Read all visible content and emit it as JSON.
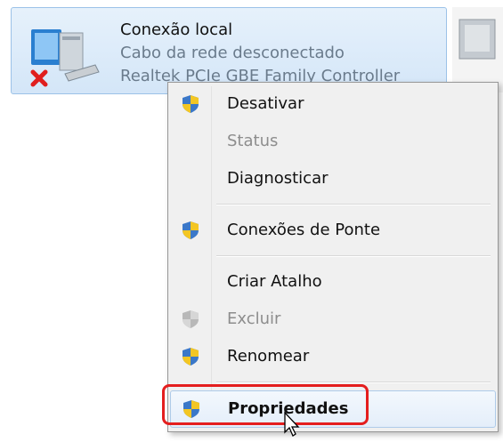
{
  "adapter": {
    "name": "Conexão local",
    "status": "Cabo da rede desconectado",
    "device": "Realtek PCIe GBE Family Controller"
  },
  "menu": {
    "items": [
      {
        "label": "Desativar",
        "shield": true,
        "enabled": true
      },
      {
        "label": "Status",
        "shield": false,
        "enabled": false
      },
      {
        "label": "Diagnosticar",
        "shield": false,
        "enabled": true
      },
      {
        "label": "Conexões de Ponte",
        "shield": true,
        "enabled": true
      },
      {
        "label": "Criar Atalho",
        "shield": false,
        "enabled": true
      },
      {
        "label": "Excluir",
        "shield": true,
        "enabled": false
      },
      {
        "label": "Renomear",
        "shield": true,
        "enabled": true
      },
      {
        "label": "Propriedades",
        "shield": true,
        "enabled": true,
        "highlighted": true,
        "bold": true
      }
    ]
  },
  "colors": {
    "highlight_border": "#e41e1e",
    "disabled_text": "#8d8d8d",
    "status_text": "#6a7b8c"
  },
  "icons": [
    "network-adapter-icon",
    "red-x-icon",
    "uac-shield-icon",
    "mouse-cursor-icon"
  ]
}
